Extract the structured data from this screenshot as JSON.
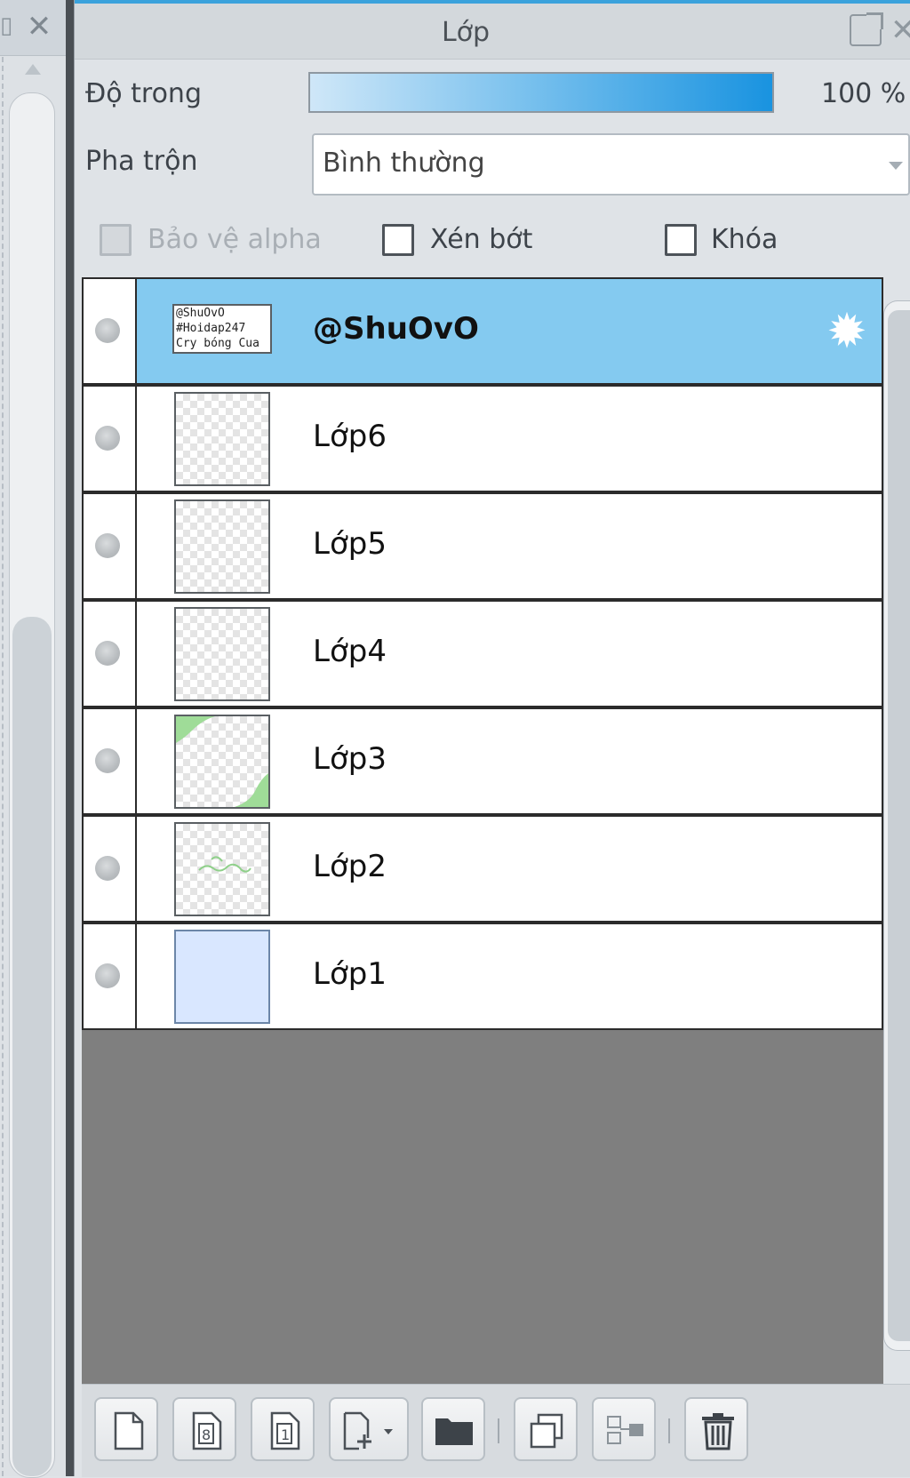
{
  "panel": {
    "title": "Lớp",
    "opacity_label": "Độ trong",
    "opacity_value": "100 %",
    "opacity_fraction": 1.0,
    "blend_label": "Pha trộn",
    "blend_value": "Bình thường",
    "checkboxes": {
      "alpha_protect": "Bảo vệ alpha",
      "clipping": "Xén bớt",
      "lock": "Khóa"
    }
  },
  "layers": [
    {
      "name": "@ShuOvO",
      "selected": true,
      "thumb_text": [
        "@ShuOvO",
        "#Hoidap247",
        "Cry bóng Cua"
      ]
    },
    {
      "name": "Lớp6",
      "selected": false
    },
    {
      "name": "Lớp5",
      "selected": false
    },
    {
      "name": "Lớp4",
      "selected": false
    },
    {
      "name": "Lớp3",
      "selected": false
    },
    {
      "name": "Lớp2",
      "selected": false
    },
    {
      "name": "Lớp1",
      "selected": false
    }
  ],
  "toolbar": {
    "buttons": [
      "new-layer-icon",
      "new-8bit-layer-icon",
      "new-1bit-layer-icon",
      "add-layer-dropdown-icon",
      "new-folder-icon",
      "duplicate-layer-icon",
      "merge-layer-icon",
      "delete-layer-icon"
    ]
  },
  "colors": {
    "selected_row": "#84caf0",
    "opacity_bar_end": "#1993e0",
    "list_background": "#7f7f7f"
  }
}
